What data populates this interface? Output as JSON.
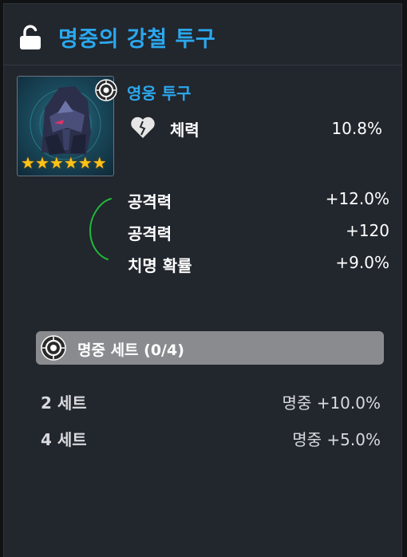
{
  "header": {
    "title": "명중의 강철 투구"
  },
  "item": {
    "type_label": "영웅 투구",
    "star_count": 6,
    "main_stat": {
      "label": "체력",
      "value": "10.8%"
    },
    "sub_stats": [
      {
        "label": "공격력",
        "value": "+12.0%"
      },
      {
        "label": "공격력",
        "value": "+120"
      },
      {
        "label": "치명 확률",
        "value": "+9.0%"
      }
    ]
  },
  "set": {
    "label": "명중 세트 (0/4)",
    "bonuses": [
      {
        "count": "2 세트",
        "effect": "명중 +10.0%"
      },
      {
        "count": "4 세트",
        "effect": "명중 +5.0%"
      }
    ]
  },
  "colors": {
    "accent": "#2ba8ee",
    "panel_bg": "#22262d",
    "set_bar_bg": "#8a8b8f",
    "star": "#ffc21a",
    "annotation": "#1fb83a"
  }
}
